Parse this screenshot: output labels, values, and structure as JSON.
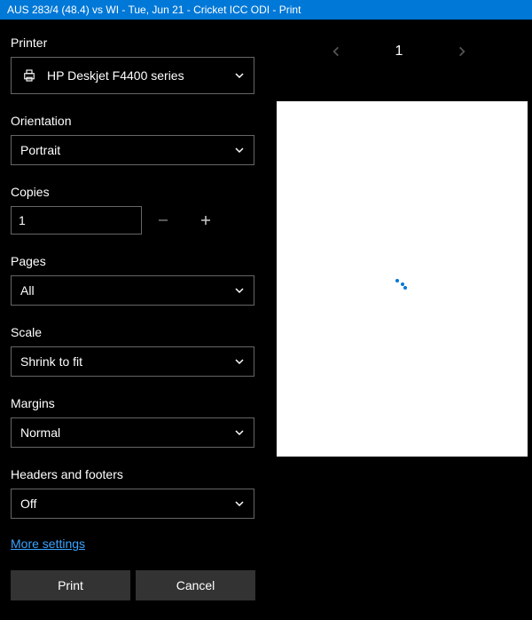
{
  "window": {
    "title": "AUS 283/4 (48.4) vs WI - Tue, Jun 21 - Cricket ICC ODI - Print"
  },
  "labels": {
    "printer": "Printer",
    "orientation": "Orientation",
    "copies": "Copies",
    "pages": "Pages",
    "scale": "Scale",
    "margins": "Margins",
    "headersFooters": "Headers and footers"
  },
  "values": {
    "printer": "HP Deskjet F4400 series",
    "orientation": "Portrait",
    "copies": "1",
    "pages": "All",
    "scale": "Shrink to fit",
    "margins": "Normal",
    "headersFooters": "Off"
  },
  "links": {
    "moreSettings": "More settings"
  },
  "buttons": {
    "print": "Print",
    "cancel": "Cancel"
  },
  "preview": {
    "currentPage": "1"
  }
}
